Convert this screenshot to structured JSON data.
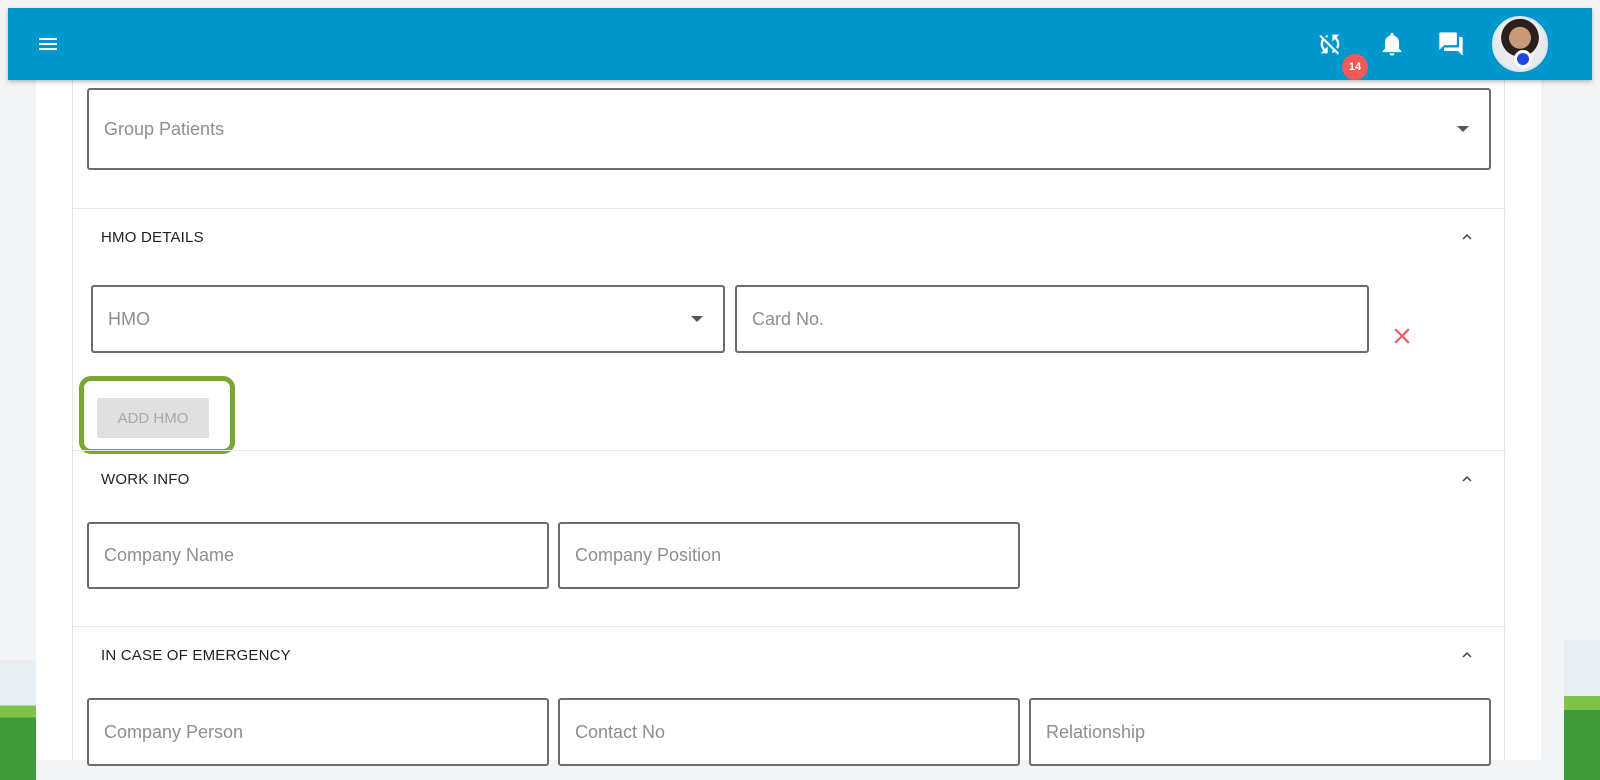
{
  "header": {
    "menu_icon": "menu-icon",
    "sync_icon": "sync-off-icon",
    "bell_icon": "bell-icon",
    "notification_count": "14",
    "chat_icon": "chat-icon",
    "avatar": "user-avatar",
    "colors": {
      "bar": "#0098cc",
      "badge": "#f05a5a",
      "status": "#1f44e8"
    }
  },
  "form": {
    "group_patients": {
      "placeholder": "Group Patients"
    },
    "hmo_details": {
      "title": "HMO DETAILS",
      "hmo_select": "HMO",
      "card_no": "Card No.",
      "add_button": "ADD HMO",
      "remove_icon": "close-icon"
    },
    "work_info": {
      "title": "WORK INFO",
      "company_name": "Company Name",
      "company_position": "Company Position"
    },
    "emergency": {
      "title": "IN CASE OF EMERGENCY",
      "company_person": "Company Person",
      "contact_no": "Contact No",
      "relationship": "Relationship"
    }
  },
  "colors": {
    "highlight": "#7aa632",
    "remove": "#f05a5a"
  }
}
